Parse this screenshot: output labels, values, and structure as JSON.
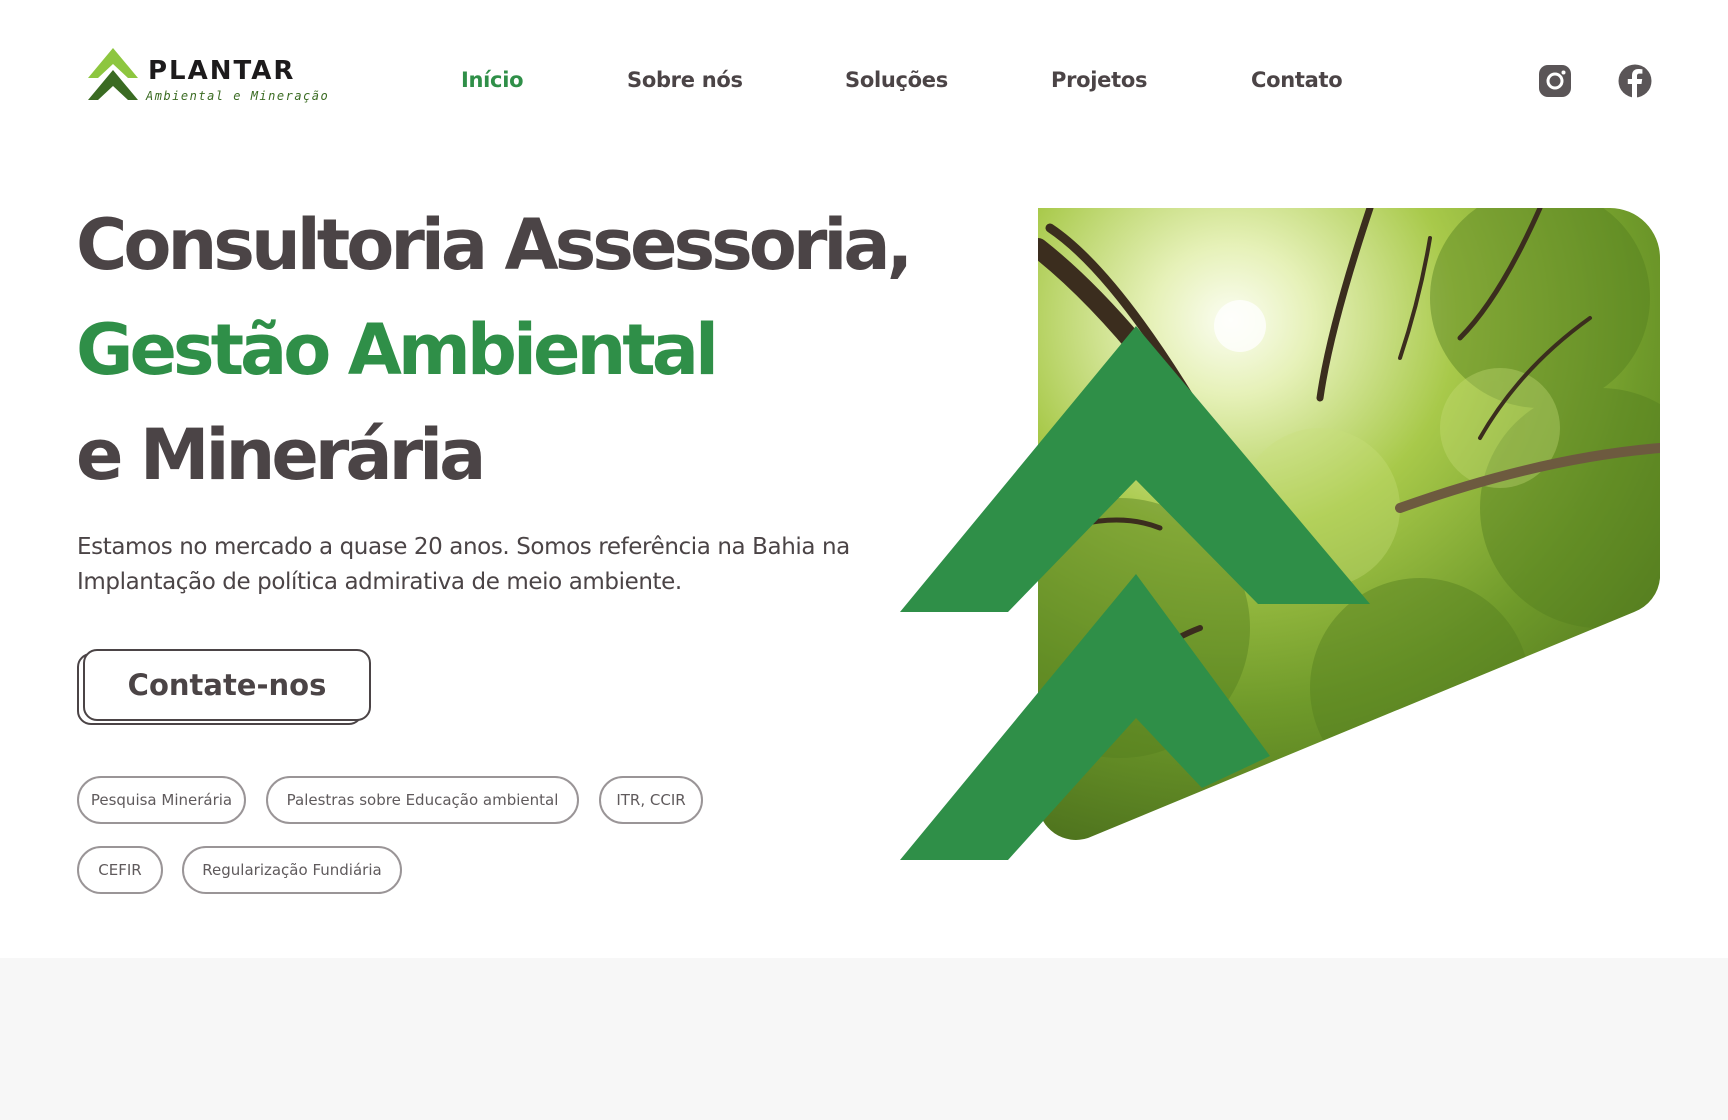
{
  "brand": {
    "name": "PLANTAR",
    "tagline": "Ambiental e Mineração",
    "logo_icon": "double-chevron-up-logo",
    "colors": {
      "light_green": "#8dc63f",
      "dark_green": "#3a6b22"
    }
  },
  "nav": {
    "items": [
      {
        "label": "Início",
        "active": true
      },
      {
        "label": "Sobre nós",
        "active": false
      },
      {
        "label": "Soluções",
        "active": false
      },
      {
        "label": "Projetos",
        "active": false
      },
      {
        "label": "Contato",
        "active": false
      }
    ],
    "social": [
      {
        "icon": "instagram-icon"
      },
      {
        "icon": "facebook-icon"
      }
    ]
  },
  "hero": {
    "line1": "Consultoria Assessoria,",
    "line2": "Gestão Ambiental",
    "line3": "e Minerária",
    "description": "Estamos no mercado a quase 20 anos. Somos referência na Bahia na Implantação de política admirativa de meio ambiente.",
    "cta_label": "Contate-nos",
    "image_subject": "forest-canopy-image",
    "decor_icon": "double-chevron-up-icon"
  },
  "tags": [
    "Pesquisa Minerária",
    "Palestras sobre Educação ambiental",
    "ITR, CCIR",
    "CEFIR",
    "Regularização Fundiária"
  ],
  "colors": {
    "accent_green": "#2f8f48",
    "text_dark": "#4b4446",
    "tag_border": "#9a9597",
    "section_bg": "#f7f7f7"
  }
}
